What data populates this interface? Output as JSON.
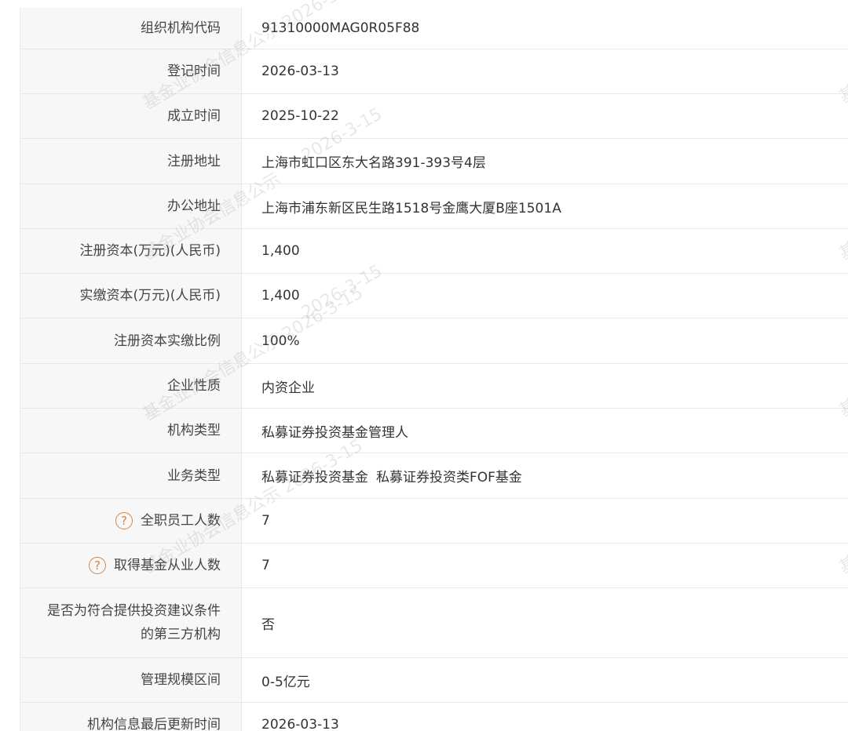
{
  "rows": [
    {
      "label": "组织机构代码",
      "value": "91310000MAG0R05F88"
    },
    {
      "label": "登记时间",
      "value": "2026-03-13"
    },
    {
      "label": "成立时间",
      "value": "2025-10-22"
    },
    {
      "label": "注册地址",
      "value": "上海市虹口区东大名路391-393号4层"
    },
    {
      "label": "办公地址",
      "value": "上海市浦东新区民生路1518号金鹰大厦B座1501A"
    },
    {
      "label": "注册资本(万元)(人民币)",
      "value": "1,400"
    },
    {
      "label": "实缴资本(万元)(人民币)",
      "value": "1,400"
    },
    {
      "label": "注册资本实缴比例",
      "value": "100%"
    },
    {
      "label": "企业性质",
      "value": "内资企业"
    },
    {
      "label": "机构类型",
      "value": "私募证券投资基金管理人"
    },
    {
      "label": "业务类型",
      "value_1": "私募证券投资基金",
      "value_2": "私募证券投资类FOF基金"
    },
    {
      "label": "全职员工人数",
      "value": "7",
      "help_icon": "question-circle-icon"
    },
    {
      "label": "取得基金从业人数",
      "value": "7",
      "help_icon": "question-circle-icon"
    },
    {
      "label_line1": "是否为符合提供投资建议条件",
      "label_line2": "的第三方机构",
      "value": "否"
    },
    {
      "label": "管理规模区间",
      "value": "0-5亿元"
    },
    {
      "label": "机构信息最后更新时间",
      "value": "2026-03-13"
    }
  ],
  "help_symbol": "?",
  "watermark": {
    "text_a": "基金业协会信息公示 2026-3-15",
    "text_b": "基金业协会信息公示",
    "text_c": "2026-3-15",
    "text_d": "基"
  },
  "colors": {
    "label_bg": "#f7f7f7",
    "border": "#e8e8e8",
    "help_icon": "#d1864a"
  }
}
